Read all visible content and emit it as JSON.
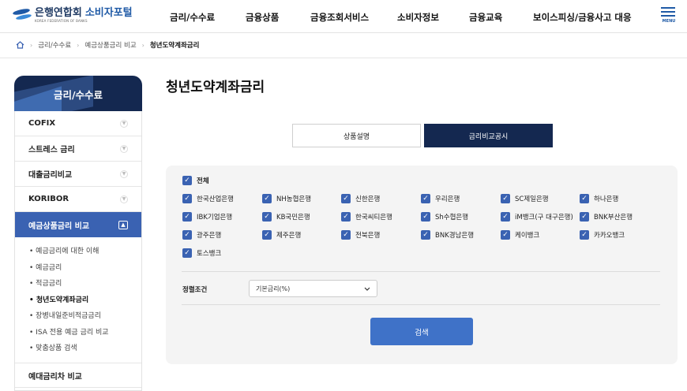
{
  "header": {
    "logo_org": "은행연합회",
    "logo_portal": "소비자포털",
    "logo_sub": "KOREA FEDERATION OF BANKS",
    "nav": [
      "금리/수수료",
      "금융상품",
      "금융조회서비스",
      "소비자정보",
      "금융교육",
      "보이스피싱/금융사고 대응"
    ],
    "menu_label": "MENU"
  },
  "breadcrumb": {
    "items": [
      "금리/수수료",
      "예금상품금리 비교",
      "청년도약계좌금리"
    ]
  },
  "sidebar": {
    "title": "금리/수수료",
    "items": [
      {
        "label": "COFIX"
      },
      {
        "label": "스트레스 금리"
      },
      {
        "label": "대출금리비교"
      },
      {
        "label": "KORIBOR"
      },
      {
        "label": "예금상품금리 비교"
      }
    ],
    "sub_items": [
      "• 예금금리에 대한 이해",
      "• 예금금리",
      "• 적금금리",
      "• 청년도약계좌금리",
      "• 장병내일준비적금금리",
      "• ISA 전용 예금 금리 비교",
      "• 맞춤상품 검색"
    ],
    "bottom_item": "예대금리차 비교"
  },
  "main": {
    "page_title": "청년도약계좌금리",
    "tabs": [
      "상품설명",
      "금리비교공시"
    ],
    "all_label": "전체",
    "banks": [
      "한국산업은행",
      "NH농협은행",
      "신한은행",
      "우리은행",
      "SC제일은행",
      "하나은행",
      "IBK기업은행",
      "KB국민은행",
      "한국씨티은행",
      "Sh수협은행",
      "iM뱅크(구 대구은행)",
      "BNK부산은행",
      "광주은행",
      "제주은행",
      "전북은행",
      "BNK경남은행",
      "케이뱅크",
      "카카오뱅크",
      "토스뱅크"
    ],
    "sort_label": "정렬조건",
    "sort_value": "기본금리(%)",
    "search_label": "검색"
  },
  "colors": {
    "accent": "#3a62b2",
    "navy": "#142850",
    "button": "#3f72c8",
    "panel_bg": "#f4f4f4"
  }
}
